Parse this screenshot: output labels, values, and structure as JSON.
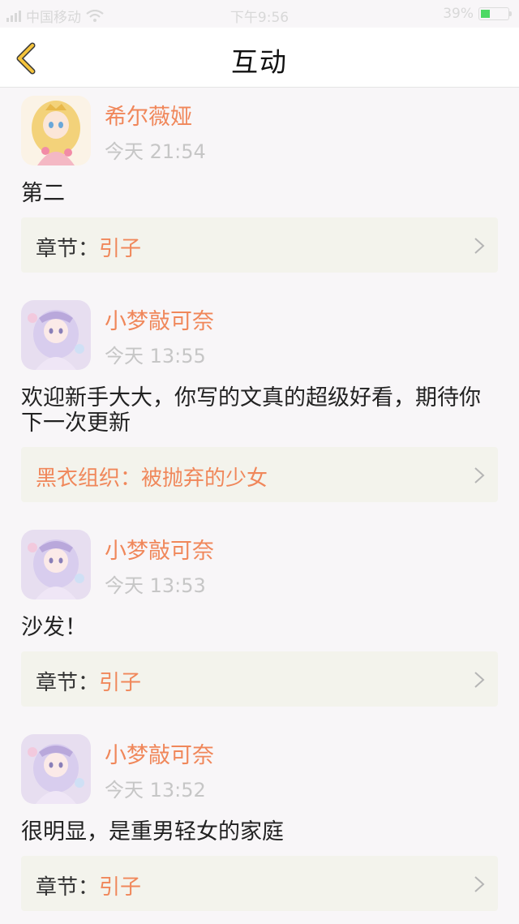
{
  "status_bar": {
    "carrier": "中国移动",
    "time": "下午9:56",
    "battery": "39%"
  },
  "nav": {
    "title": "互动",
    "back_icon": "chevron-left-icon"
  },
  "colors": {
    "accent": "#f0875a",
    "back_icon": "#f5c43c",
    "card_bg": "#f3f3ec",
    "timestamp": "#c6c6c6"
  },
  "posts": [
    {
      "user": "希尔薇娅",
      "time": "今天 21:54",
      "content": "第二",
      "chapter_label": "章节：",
      "chapter_value": "引子"
    },
    {
      "user": "小梦敲可奈",
      "time": "今天 13:55",
      "content": "欢迎新手大大，你写的文真的超级好看，期待你下一次更新",
      "chapter_label": "黑衣组织：",
      "chapter_value": "被抛弃的少女"
    },
    {
      "user": "小梦敲可奈",
      "time": "今天 13:53",
      "content": "沙发！",
      "chapter_label": "章节：",
      "chapter_value": "引子"
    },
    {
      "user": "小梦敲可奈",
      "time": "今天 13:52",
      "content": "很明显，是重男轻女的家庭",
      "chapter_label": "章节：",
      "chapter_value": "引子"
    }
  ]
}
